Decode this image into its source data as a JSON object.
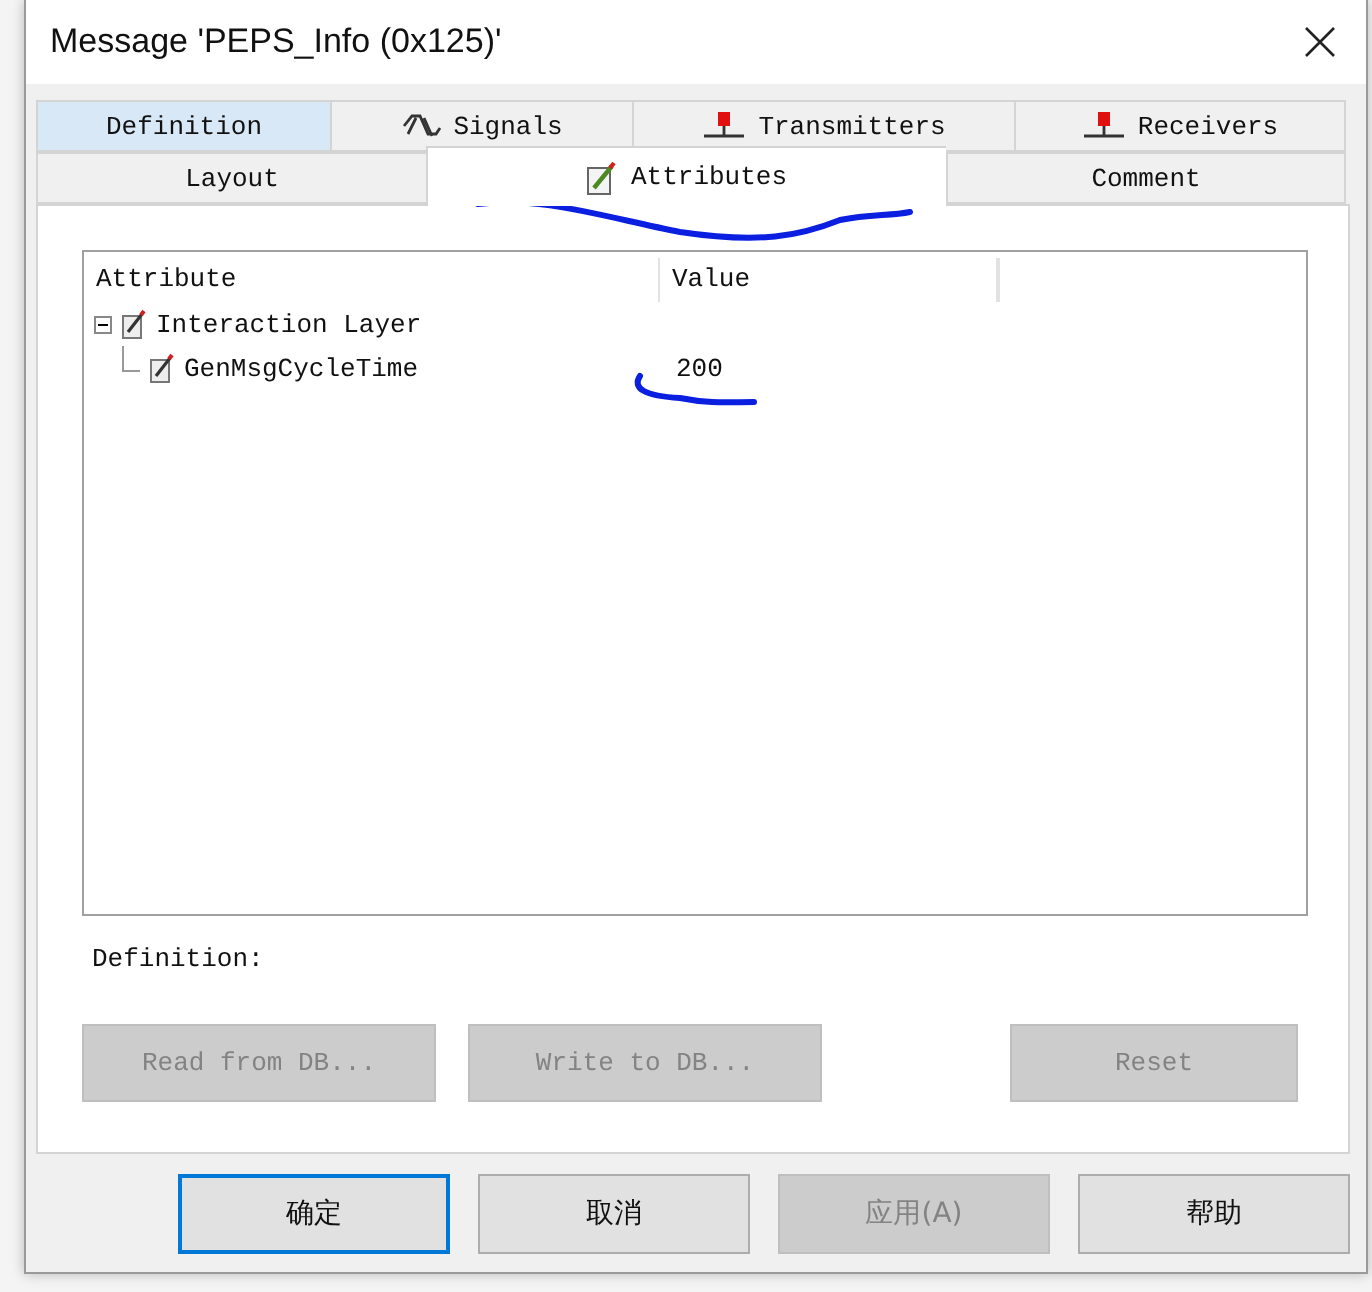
{
  "window": {
    "title": "Message 'PEPS_Info (0x125)'"
  },
  "tab_rows": [
    [
      {
        "label": "Definition",
        "kind": "plain",
        "selected": false,
        "highlighted": true
      },
      {
        "label": "Signals",
        "kind": "signal",
        "selected": false,
        "highlighted": false
      },
      {
        "label": "Transmitters",
        "kind": "node",
        "selected": false,
        "highlighted": false
      },
      {
        "label": "Receivers",
        "kind": "node",
        "selected": false,
        "highlighted": false
      }
    ],
    [
      {
        "label": "Layout",
        "kind": "plain",
        "selected": false,
        "highlighted": false
      },
      {
        "label": "Attributes",
        "kind": "attribute",
        "selected": true,
        "highlighted": false
      },
      {
        "label": "Comment",
        "kind": "plain",
        "selected": false,
        "highlighted": false
      }
    ]
  ],
  "attributes": {
    "columns": [
      "Attribute",
      "Value"
    ],
    "rows": [
      {
        "name": "Interaction Layer",
        "expanded": true,
        "children": [
          {
            "name": "GenMsgCycleTime",
            "value": "200"
          }
        ]
      }
    ]
  },
  "definition_label": "Definition:",
  "actions": [
    {
      "label": "Read from DB...",
      "disabled": true
    },
    {
      "label": "Write to DB...",
      "disabled": true
    },
    {
      "label": "Reset",
      "disabled": true
    }
  ],
  "buttons": [
    {
      "label": "确定",
      "default": true,
      "disabled": false
    },
    {
      "label": "取消",
      "default": false,
      "disabled": false
    },
    {
      "label": "应用(A)",
      "default": false,
      "disabled": true
    },
    {
      "label": "帮助",
      "default": false,
      "disabled": false
    }
  ]
}
